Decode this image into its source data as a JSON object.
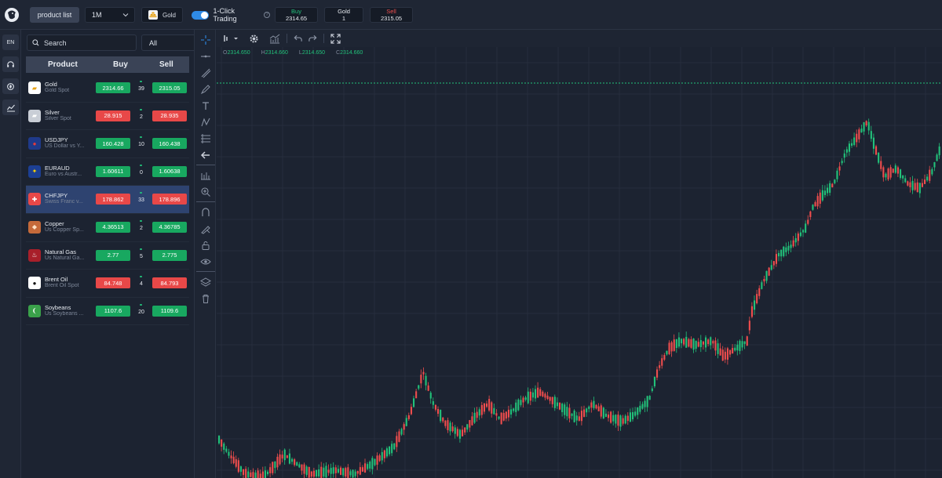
{
  "topbar": {
    "product_list_label": "product list",
    "timeframe": "1M",
    "symbol": "Gold",
    "one_click_label": "1-Click Trading",
    "one_click_enabled": true,
    "buy_label": "Buy",
    "buy_price": "2314.65",
    "qty_label": "Gold",
    "qty_value": "1",
    "sell_label": "Sell",
    "sell_price": "2315.05"
  },
  "rail": {
    "lang": "EN",
    "icons": [
      "headset-icon",
      "coins-icon",
      "chart-icon"
    ]
  },
  "panel": {
    "search_placeholder": "Search",
    "filter": "All",
    "headers": {
      "product": "Product",
      "buy": "Buy",
      "sell": "Sell"
    },
    "products": [
      {
        "name": "Gold",
        "sub": "Gold Spot",
        "buy": "2314.66",
        "spread": "39",
        "sell": "2315.05",
        "buy_color": "green",
        "sell_color": "green",
        "icon_bg": "#ffffff",
        "icon_fg": "#e8a317",
        "icon_glyph": "▰",
        "icon_name": "gold-bars-icon"
      },
      {
        "name": "Silver",
        "sub": "Silver Spot",
        "buy": "28.915",
        "spread": "2",
        "sell": "28.935",
        "buy_color": "red",
        "sell_color": "red",
        "icon_bg": "#c9ced6",
        "icon_fg": "#ffffff",
        "icon_glyph": "▰",
        "icon_name": "silver-bars-icon"
      },
      {
        "name": "USDJPY",
        "sub": "US Dollar vs Y...",
        "buy": "160.428",
        "spread": "10",
        "sell": "160.438",
        "buy_color": "green",
        "sell_color": "green",
        "icon_bg": "#1f3a8a",
        "icon_fg": "#e63b3b",
        "icon_glyph": "●",
        "icon_name": "us-japan-flag-icon"
      },
      {
        "name": "EURAUD",
        "sub": "Euro vs Austr...",
        "buy": "1.60611",
        "spread": "0",
        "sell": "1.60638",
        "buy_color": "green",
        "sell_color": "green",
        "icon_bg": "#1c3f94",
        "icon_fg": "#ffd400",
        "icon_glyph": "✦",
        "icon_name": "eu-australia-flag-icon"
      },
      {
        "name": "CHFJPY",
        "sub": "Swiss Franc v...",
        "buy": "178.862",
        "spread": "33",
        "sell": "178.896",
        "buy_color": "red",
        "sell_color": "red",
        "icon_bg": "#e84848",
        "icon_fg": "#ffffff",
        "icon_glyph": "✚",
        "icon_name": "swiss-flag-icon",
        "selected": true
      },
      {
        "name": "Copper",
        "sub": "Us Copper Sp...",
        "buy": "4.36513",
        "spread": "2",
        "sell": "4.36785",
        "buy_color": "green",
        "sell_color": "green",
        "icon_bg": "#c56a3a",
        "icon_fg": "#ffe1c4",
        "icon_glyph": "◆",
        "icon_name": "copper-icon"
      },
      {
        "name": "Natural Gas",
        "sub": "Us Natural Ga...",
        "buy": "2.77",
        "spread": "5",
        "sell": "2.775",
        "buy_color": "green",
        "sell_color": "green",
        "icon_bg": "#a81f2a",
        "icon_fg": "#ffffff",
        "icon_glyph": "♨",
        "icon_name": "natural-gas-icon"
      },
      {
        "name": "Brent Oil",
        "sub": "Brent Oil Spot",
        "buy": "84.748",
        "spread": "4",
        "sell": "84.793",
        "buy_color": "red",
        "sell_color": "red",
        "icon_bg": "#ffffff",
        "icon_fg": "#111111",
        "icon_glyph": "●",
        "icon_name": "oil-drop-icon"
      },
      {
        "name": "Soybeans",
        "sub": "Us Soybeans ...",
        "buy": "1107.6",
        "spread": "20",
        "sell": "1109.6",
        "buy_color": "green",
        "sell_color": "green",
        "icon_bg": "#3aa14a",
        "icon_fg": "#ffffff",
        "icon_glyph": "❨",
        "icon_name": "soybean-icon"
      }
    ]
  },
  "chart": {
    "ohlc": {
      "o_label": "O",
      "o": "2314.650",
      "h_label": "H",
      "h": "2314.660",
      "l_label": "L",
      "l": "2314.650",
      "c_label": "C",
      "c": "2314.660"
    },
    "colors": {
      "up": "#22c17a",
      "down": "#ef4d4d",
      "grid": "#262e3d",
      "bg": "#1c2331"
    }
  }
}
